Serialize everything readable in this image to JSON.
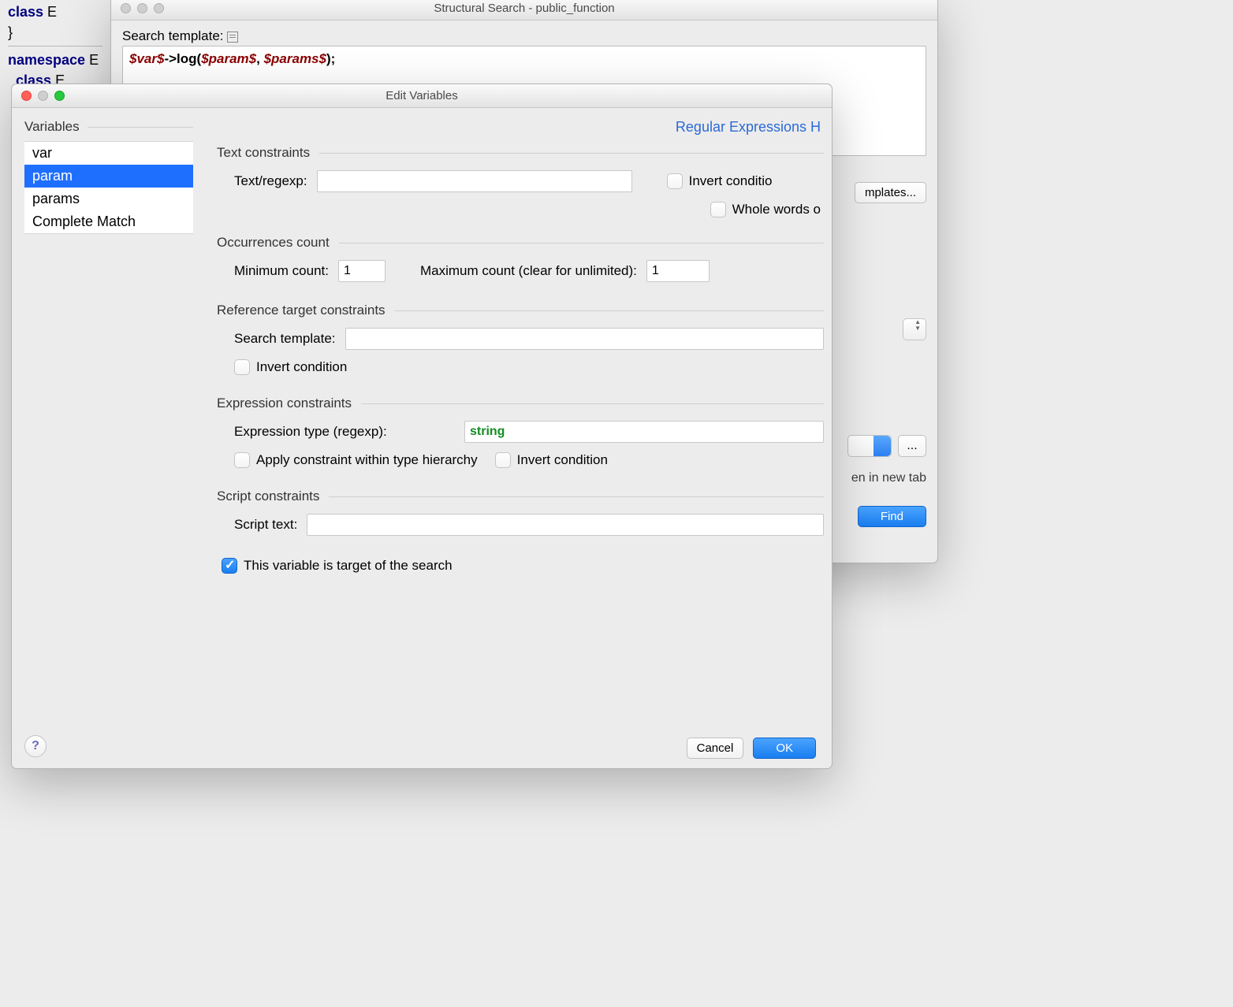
{
  "code_background": {
    "line1_kw": "class",
    "line1_rest": " E",
    "line2": "}",
    "line3_kw": "namespace",
    "line3_rest": " E",
    "line4_kw": "class",
    "line4_rest": " E"
  },
  "search_window": {
    "title": "Structural Search - public_function",
    "template_label": "Search template: ",
    "template_code": {
      "v1": "$var$",
      "p1": "->log(",
      "v2": "$param$",
      "p2": ", ",
      "v3": "$params$",
      "p3": ");"
    },
    "templates_button": "mplates...",
    "open_in_new_tab": "en in new tab",
    "find": "Find"
  },
  "edit_window": {
    "title": "Edit Variables",
    "regex_link": "Regular Expressions H",
    "sidebar": {
      "header": "Variables",
      "items": [
        "var",
        "param",
        "params",
        "Complete Match"
      ],
      "selected_index": 1
    },
    "sections": {
      "text": {
        "title": "Text constraints",
        "text_label": "Text/regexp:",
        "text_value": "",
        "invert_label": "Invert conditio",
        "whole_words_label": "Whole words o"
      },
      "occurrences": {
        "title": "Occurrences count",
        "min_label": "Minimum count:",
        "min_value": "1",
        "max_label": "Maximum count (clear for unlimited):",
        "max_value": "1"
      },
      "reference": {
        "title": "Reference target constraints",
        "template_label": "Search template:",
        "template_value": "",
        "invert_label": "Invert condition"
      },
      "expression": {
        "title": "Expression constraints",
        "type_label": "Expression type (regexp):",
        "type_value": "string",
        "apply_hierarchy": "Apply constraint within type hierarchy",
        "invert_label": "Invert condition"
      },
      "script": {
        "title": "Script constraints",
        "text_label": "Script text:",
        "text_value": ""
      },
      "target": {
        "label": "This variable is target of the search",
        "checked": true
      }
    },
    "buttons": {
      "help": "?",
      "cancel": "Cancel",
      "ok": "OK"
    }
  }
}
